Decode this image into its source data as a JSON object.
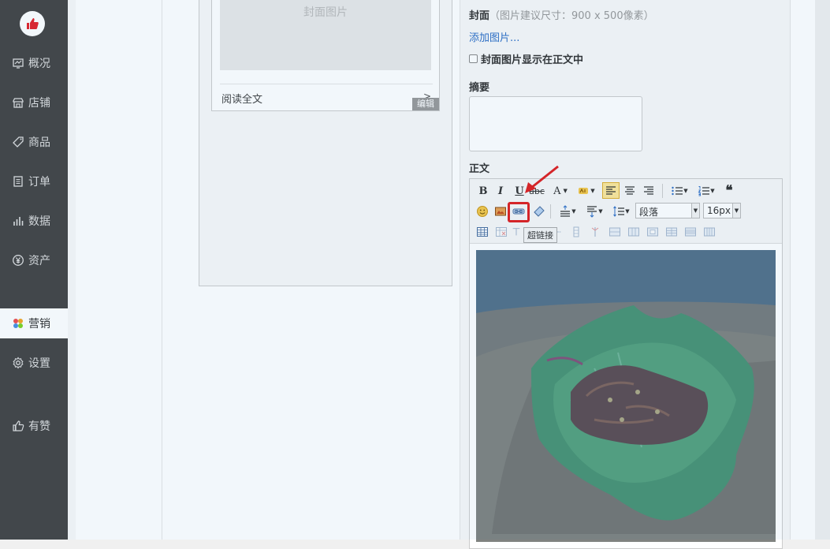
{
  "sidebar": {
    "items": [
      {
        "label": "概况",
        "icon": "dashboard-icon"
      },
      {
        "label": "店铺",
        "icon": "store-icon"
      },
      {
        "label": "商品",
        "icon": "tag-icon"
      },
      {
        "label": "订单",
        "icon": "order-icon"
      },
      {
        "label": "数据",
        "icon": "chart-icon"
      },
      {
        "label": "资产",
        "icon": "yuan-icon"
      },
      {
        "label": "营销",
        "icon": "marketing-icon",
        "active": true
      },
      {
        "label": "设置",
        "icon": "gear-icon"
      },
      {
        "label": "有赞",
        "icon": "thumbs-up-icon"
      }
    ]
  },
  "preview": {
    "cover_placeholder": "封面图片",
    "read_all": "阅读全文",
    "read_arrow": ">",
    "edit_badge": "编辑"
  },
  "form": {
    "cover_label": "封面",
    "cover_hint": "（图片建议尺寸：900 x 500像素）",
    "add_image_link": "添加图片...",
    "show_cover_label": "封面图片显示在正文中",
    "show_cover_checked": false,
    "summary_label": "摘要",
    "summary_value": "",
    "body_label": "正文"
  },
  "toolbar": {
    "bold": "B",
    "italic": "I",
    "underline": "U",
    "strike": "abc",
    "font_color": "A",
    "paragraph_select": "段落",
    "font_size_select": "16px",
    "tooltip": "超链接"
  },
  "colors": {
    "sidebar_bg": "#444444",
    "link": "#2f6fc6",
    "highlight": "#e02020"
  }
}
